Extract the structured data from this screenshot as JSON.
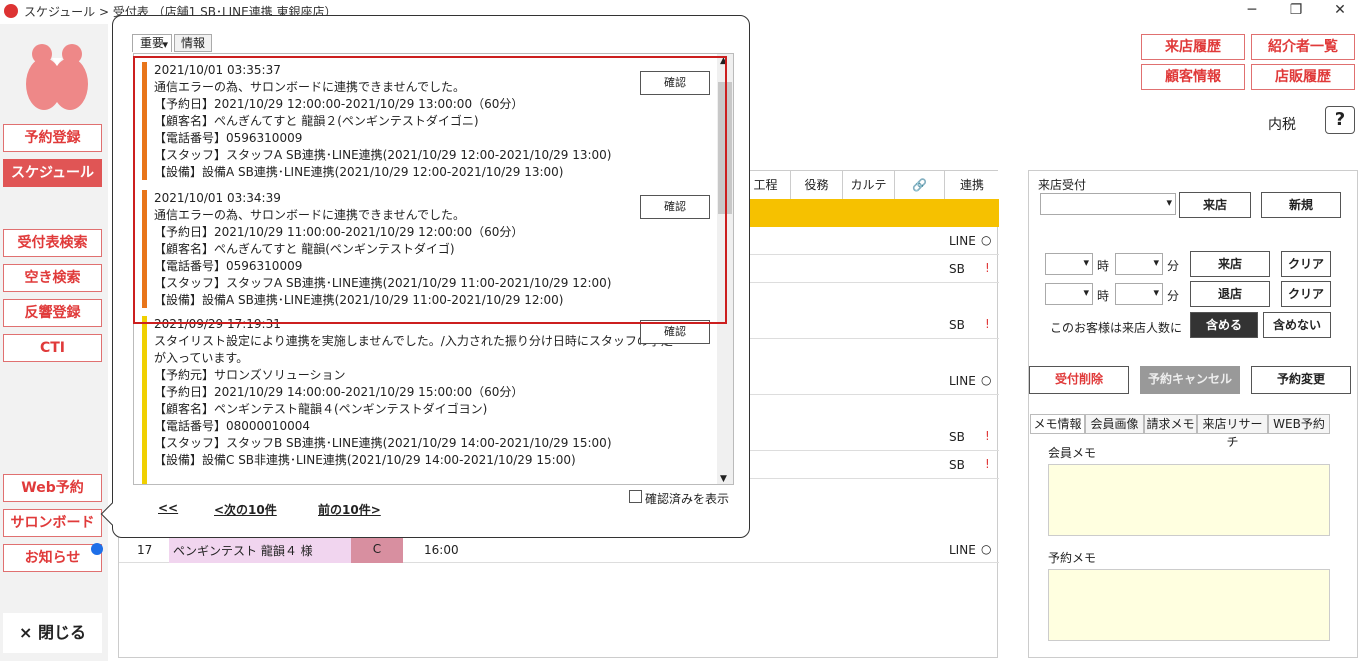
{
  "title": "スケジュール > 受付表 （店舗1 SB･LINE連携 東銀座店）",
  "sidebar": {
    "reserve": "予約登録",
    "schedule": "スケジュール",
    "search": "受付表検索",
    "vacancy": "空き検索",
    "response": "反響登録",
    "cti": "CTI",
    "web": "Web予約",
    "salon": "サロンボード",
    "news": "お知らせ",
    "close": "× 閉じる"
  },
  "topright": {
    "visit_history": "来店履歴",
    "referrer_list": "紹介者一覧",
    "customer_info": "顧客情報",
    "store_sales": "店販履歴",
    "tax": "内税",
    "help": "?"
  },
  "table": {
    "headers": [
      "工程",
      "役務",
      "カルテ",
      "🔗",
      "連携"
    ],
    "rows": [
      {
        "link": "LINE",
        "mark": "○"
      },
      {
        "link": "SB",
        "mark": "!"
      },
      {
        "link": "",
        "mark": ""
      },
      {
        "link": "SB",
        "mark": "!"
      },
      {
        "link": "",
        "mark": ""
      },
      {
        "link": "LINE",
        "mark": "○"
      },
      {
        "link": "",
        "mark": ""
      },
      {
        "link": "SB",
        "mark": "!"
      },
      {
        "link": "SB",
        "mark": "!"
      }
    ],
    "last_row": {
      "no": "17",
      "name": "ペンギンテスト 龍韻４ 様",
      "code": "C",
      "time": "16:00",
      "link": "LINE",
      "mark": "○"
    }
  },
  "reception": {
    "label": "来店受付",
    "visit": "来店",
    "new": "新規",
    "hour": "時",
    "minute": "分",
    "arrive": "来店",
    "leave": "退店",
    "clear": "クリア",
    "count_text": "このお客様は来店人数に",
    "include": "含める",
    "exclude": "含めない",
    "delete": "受付削除",
    "cancel": "予約キャンセル",
    "change": "予約変更"
  },
  "info_tabs": [
    "メモ情報",
    "会員画像",
    "請求メモ",
    "来店リサーチ",
    "WEB予約"
  ],
  "member_memo": "会員メモ",
  "reserve_memo": "予約メモ",
  "popup": {
    "tabs": [
      "重要",
      "情報"
    ],
    "confirm": "確認",
    "entries": [
      {
        "color": "#e8751a",
        "text": "2021/10/01 03:35:37\n通信エラーの為、サロンボードに連携できませんでした。\n【予約日】2021/10/29 12:00:00-2021/10/29 13:00:00（60分）\n【顧客名】ぺんぎんてすと 龍韻２(ペンギンテストダイゴニ)\n【電話番号】0596310009\n【スタッフ】スタッフA SB連携･LINE連携(2021/10/29 12:00-2021/10/29 13:00)\n【設備】設備A SB連携･LINE連携(2021/10/29 12:00-2021/10/29 13:00)"
      },
      {
        "color": "#e8751a",
        "text": "2021/10/01 03:34:39\n通信エラーの為、サロンボードに連携できませんでした。\n【予約日】2021/10/29 11:00:00-2021/10/29 12:00:00（60分）\n【顧客名】ぺんぎんてすと 龍韻(ペンギンテストダイゴ)\n【電話番号】0596310009\n【スタッフ】スタッフA SB連携･LINE連携(2021/10/29 11:00-2021/10/29 12:00)\n【設備】設備A SB連携･LINE連携(2021/10/29 11:00-2021/10/29 12:00)"
      },
      {
        "color": "#f0d000",
        "text": "2021/09/29 17:19:31\nスタイリスト設定により連携を実施しませんでした。/入力された振り分け日時にスタッフの予定\nが入っています。\n【予約元】サロンズソリューション\n【予約日】2021/10/29 14:00:00-2021/10/29 15:00:00（60分）\n【顧客名】ペンギンテスト龍韻４(ペンギンテストダイゴヨン)\n【電話番号】08000010004\n【スタッフ】スタッフB SB連携･LINE連携(2021/10/29 14:00-2021/10/29 15:00)\n【設備】設備C SB非連携･LINE連携(2021/10/29 14:00-2021/10/29 15:00)"
      }
    ],
    "show_confirmed": "確認済みを表示",
    "first": "<<",
    "next": "<次の10件",
    "prev": "前の10件>"
  }
}
